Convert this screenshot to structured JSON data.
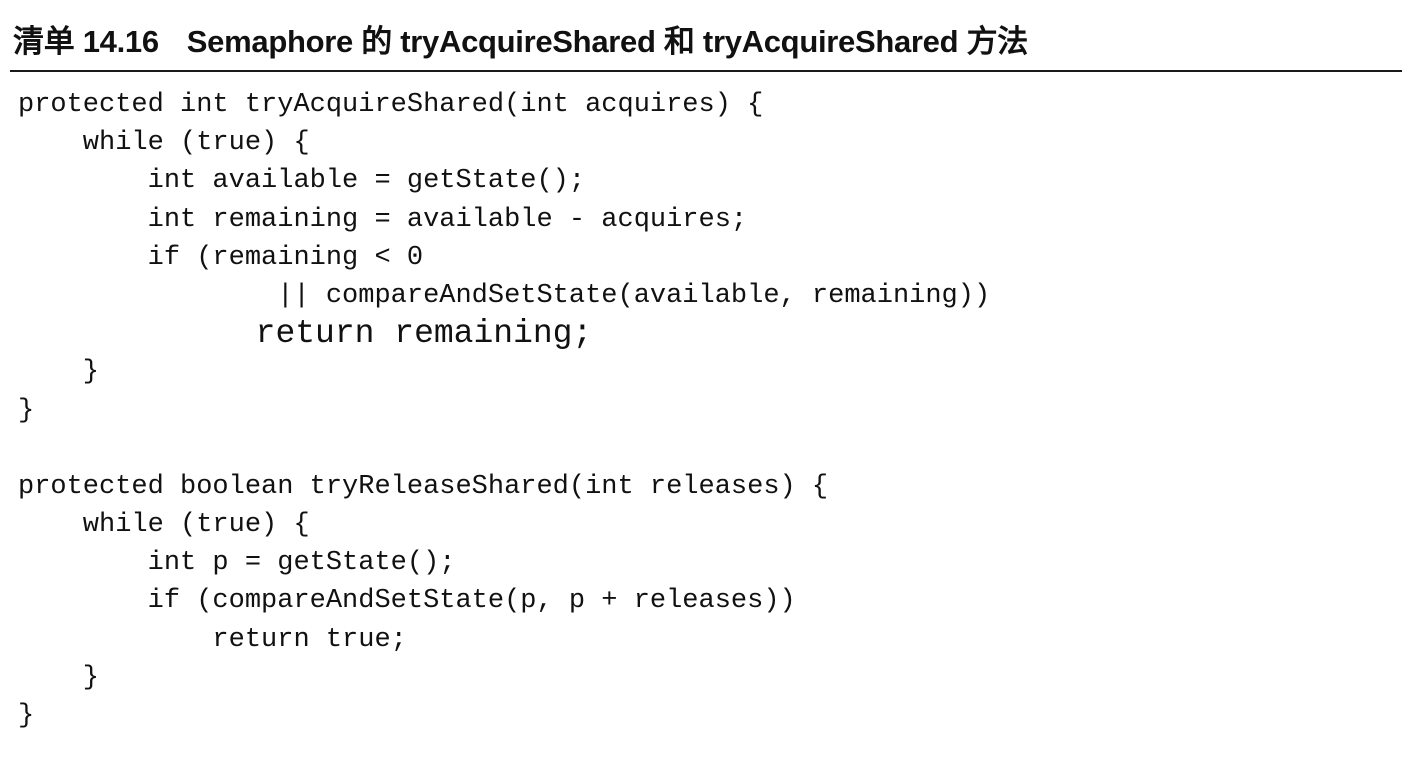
{
  "listing": {
    "label": "清单 14.16",
    "title": "Semaphore 的 tryAcquireShared 和 tryAcquireShared 方法"
  },
  "code_lines": [
    "protected int tryAcquireShared(int acquires) {",
    "    while (true) {",
    "        int available = getState();",
    "        int remaining = available - acquires;",
    "        if (remaining < 0",
    "                || compareAndSetState(available, remaining))",
    "            return remaining;",
    "    }",
    "}",
    "",
    "protected boolean tryReleaseShared(int releases) {",
    "    while (true) {",
    "        int p = getState();",
    "        if (compareAndSetState(p, p + releases))",
    "            return true;",
    "    }",
    "}"
  ]
}
